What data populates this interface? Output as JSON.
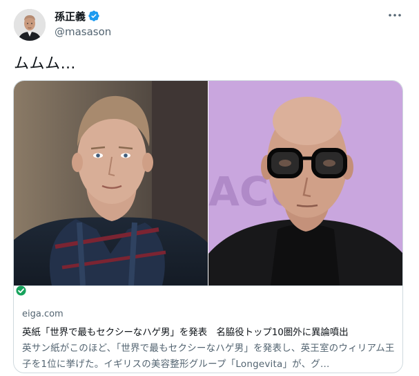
{
  "author": {
    "display_name": "孫正義",
    "handle": "@masason",
    "verified": true
  },
  "tweet": {
    "text": "ムムム…"
  },
  "card": {
    "domain": "eiga.com",
    "title": "英紙「世界で最もセクシーなハゲ男」を発表　名脇役トップ10圏外に異論噴出",
    "description": "英サン紙がこのほど、「世界で最もセクシーなハゲ男」を発表し、英王室のウィリアム王子を1位に挙げた。イギリスの美容整形グループ「Longevita」が、グ..."
  },
  "icons": {
    "verified": "verified-badge-icon",
    "more": "more-options-icon",
    "card_status": "green-check-icon"
  },
  "colors": {
    "verified_blue": "#1d9bf0",
    "muted_text": "#536471",
    "border": "#cfd9de",
    "check_green": "#17a35d"
  }
}
